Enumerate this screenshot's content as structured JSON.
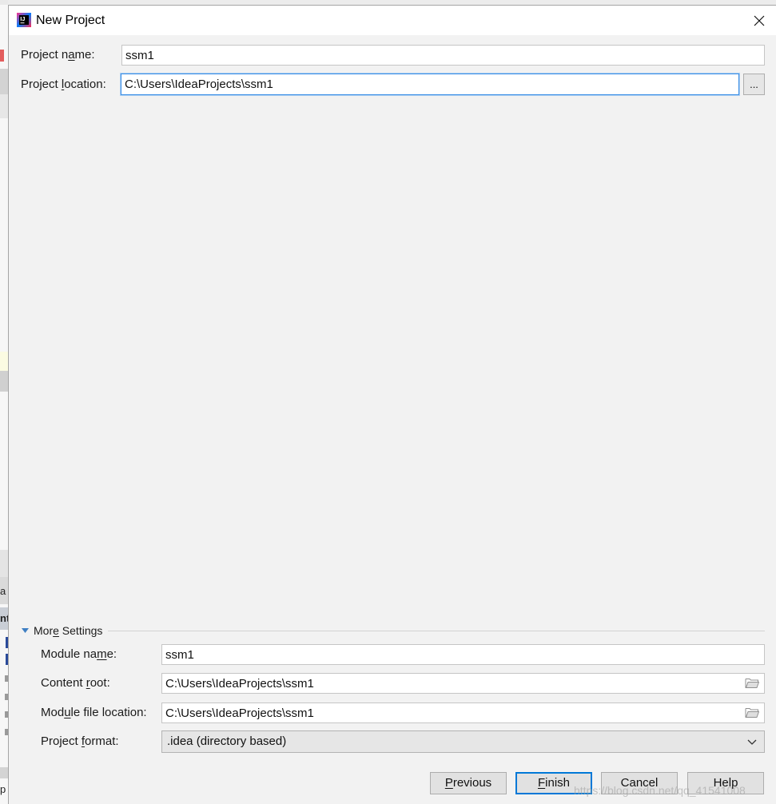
{
  "window": {
    "title": "New Project",
    "logo_text": "IJ"
  },
  "form": {
    "project_name": {
      "label": "Project name:",
      "mnemonic": "a",
      "value": "ssm1"
    },
    "project_location": {
      "label": "Project location:",
      "mnemonic": "l",
      "value": "C:\\Users\\IdeaProjects\\ssm1",
      "focused": true,
      "browse_label": "..."
    }
  },
  "more_settings": {
    "title": "More Settings",
    "mnemonic": "e",
    "expanded": true,
    "module_name": {
      "label": "Module name:",
      "mnemonic": "m",
      "value": "ssm1"
    },
    "content_root": {
      "label": "Content root:",
      "mnemonic": "r",
      "value": "C:\\Users\\IdeaProjects\\ssm1"
    },
    "module_file_location": {
      "label": "Module file location:",
      "mnemonic": "u",
      "value": "C:\\Users\\IdeaProjects\\ssm1"
    },
    "project_format": {
      "label": "Project format:",
      "mnemonic": "f",
      "selected": ".idea (directory based)"
    }
  },
  "buttons": {
    "previous": {
      "label": "Previous",
      "mnemonic": "P"
    },
    "finish": {
      "label": "Finish",
      "mnemonic": "F",
      "is_default": true
    },
    "cancel": {
      "label": "Cancel"
    },
    "help": {
      "label": "Help"
    }
  },
  "background_ide": {
    "fragments": [
      "a",
      "nt",
      "p"
    ]
  },
  "watermark": "https://blog.csdn.net/qq_41541008",
  "icons": {
    "app": "intellij-app-icon",
    "close": "close-icon",
    "folder": "folder-icon",
    "dropdown": "chevron-down-icon",
    "expand": "triangle-down-icon"
  },
  "colors": {
    "accent": "#3a8ee6",
    "focus_glow": "#a9cdf1",
    "default_button": "#0078d7",
    "dialog_background": "#f2f2f2",
    "title_bar_background": "#ffffff",
    "expand_icon": "#3f7fc3"
  }
}
